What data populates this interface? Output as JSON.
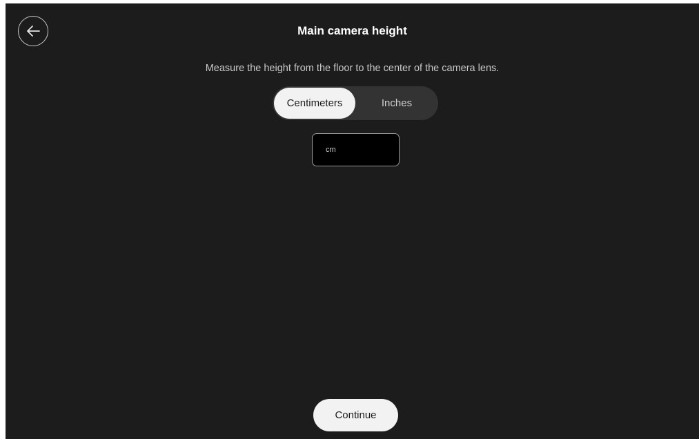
{
  "header": {
    "title": "Main camera height",
    "back_icon": "arrow-left-icon"
  },
  "instructions": "Measure the height from the floor to the center of the camera lens.",
  "unit_toggle": {
    "options": [
      {
        "label": "Centimeters",
        "selected": true
      },
      {
        "label": "Inches",
        "selected": false
      }
    ]
  },
  "height_input": {
    "value": "",
    "placeholder": "cm"
  },
  "footer": {
    "continue_label": "Continue"
  },
  "colors": {
    "background": "#1c1c1c",
    "selected_pill": "#f2f2f2",
    "toggle_track": "#333333",
    "input_background": "#000000"
  }
}
